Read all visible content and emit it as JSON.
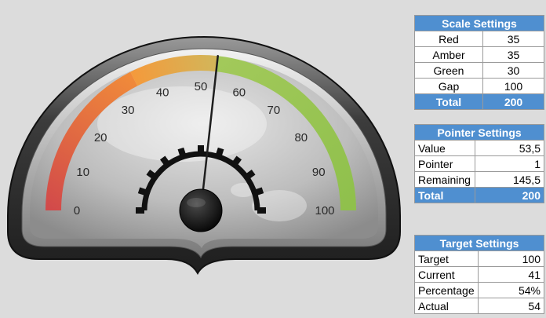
{
  "gauge": {
    "min": 0,
    "max": 100,
    "tick_labels": [
      "0",
      "10",
      "20",
      "30",
      "40",
      "50",
      "60",
      "70",
      "80",
      "90",
      "100"
    ],
    "value": 53.5,
    "bands": [
      {
        "name": "Red",
        "from": 0,
        "to": 35,
        "color_from": "#d24a4a",
        "color_to": "#f08a3a"
      },
      {
        "name": "Amber",
        "from": 35,
        "to": 53.5,
        "color_from": "#f49a3c",
        "color_to": "#d2b65a"
      },
      {
        "name": "Green",
        "from": 53.5,
        "to": 100,
        "color_from": "#a2c95a",
        "color_to": "#8fc04c"
      }
    ],
    "colors": {
      "bezel": "#3a3a3a",
      "face": "#c8c8c8",
      "needle": "#222222"
    }
  },
  "scale_settings": {
    "title": "Scale Settings",
    "rows": [
      {
        "label": "Red",
        "value": "35"
      },
      {
        "label": "Amber",
        "value": "35"
      },
      {
        "label": "Green",
        "value": "30"
      },
      {
        "label": "Gap",
        "value": "100"
      }
    ],
    "total_label": "Total",
    "total_value": "200"
  },
  "pointer_settings": {
    "title": "Pointer Settings",
    "rows": [
      {
        "label": "Value",
        "value": "53,5"
      },
      {
        "label": "Pointer",
        "value": "1"
      },
      {
        "label": "Remaining",
        "value": "145,5"
      }
    ],
    "total_label": "Total",
    "total_value": "200"
  },
  "target_settings": {
    "title": "Target Settings",
    "rows": [
      {
        "label": "Target",
        "value": "100"
      },
      {
        "label": "Current",
        "value": "41"
      },
      {
        "label": "Percentage",
        "value": "54%"
      },
      {
        "label": "Actual",
        "value": "54"
      }
    ]
  },
  "accent_color": "#4f8fd0"
}
